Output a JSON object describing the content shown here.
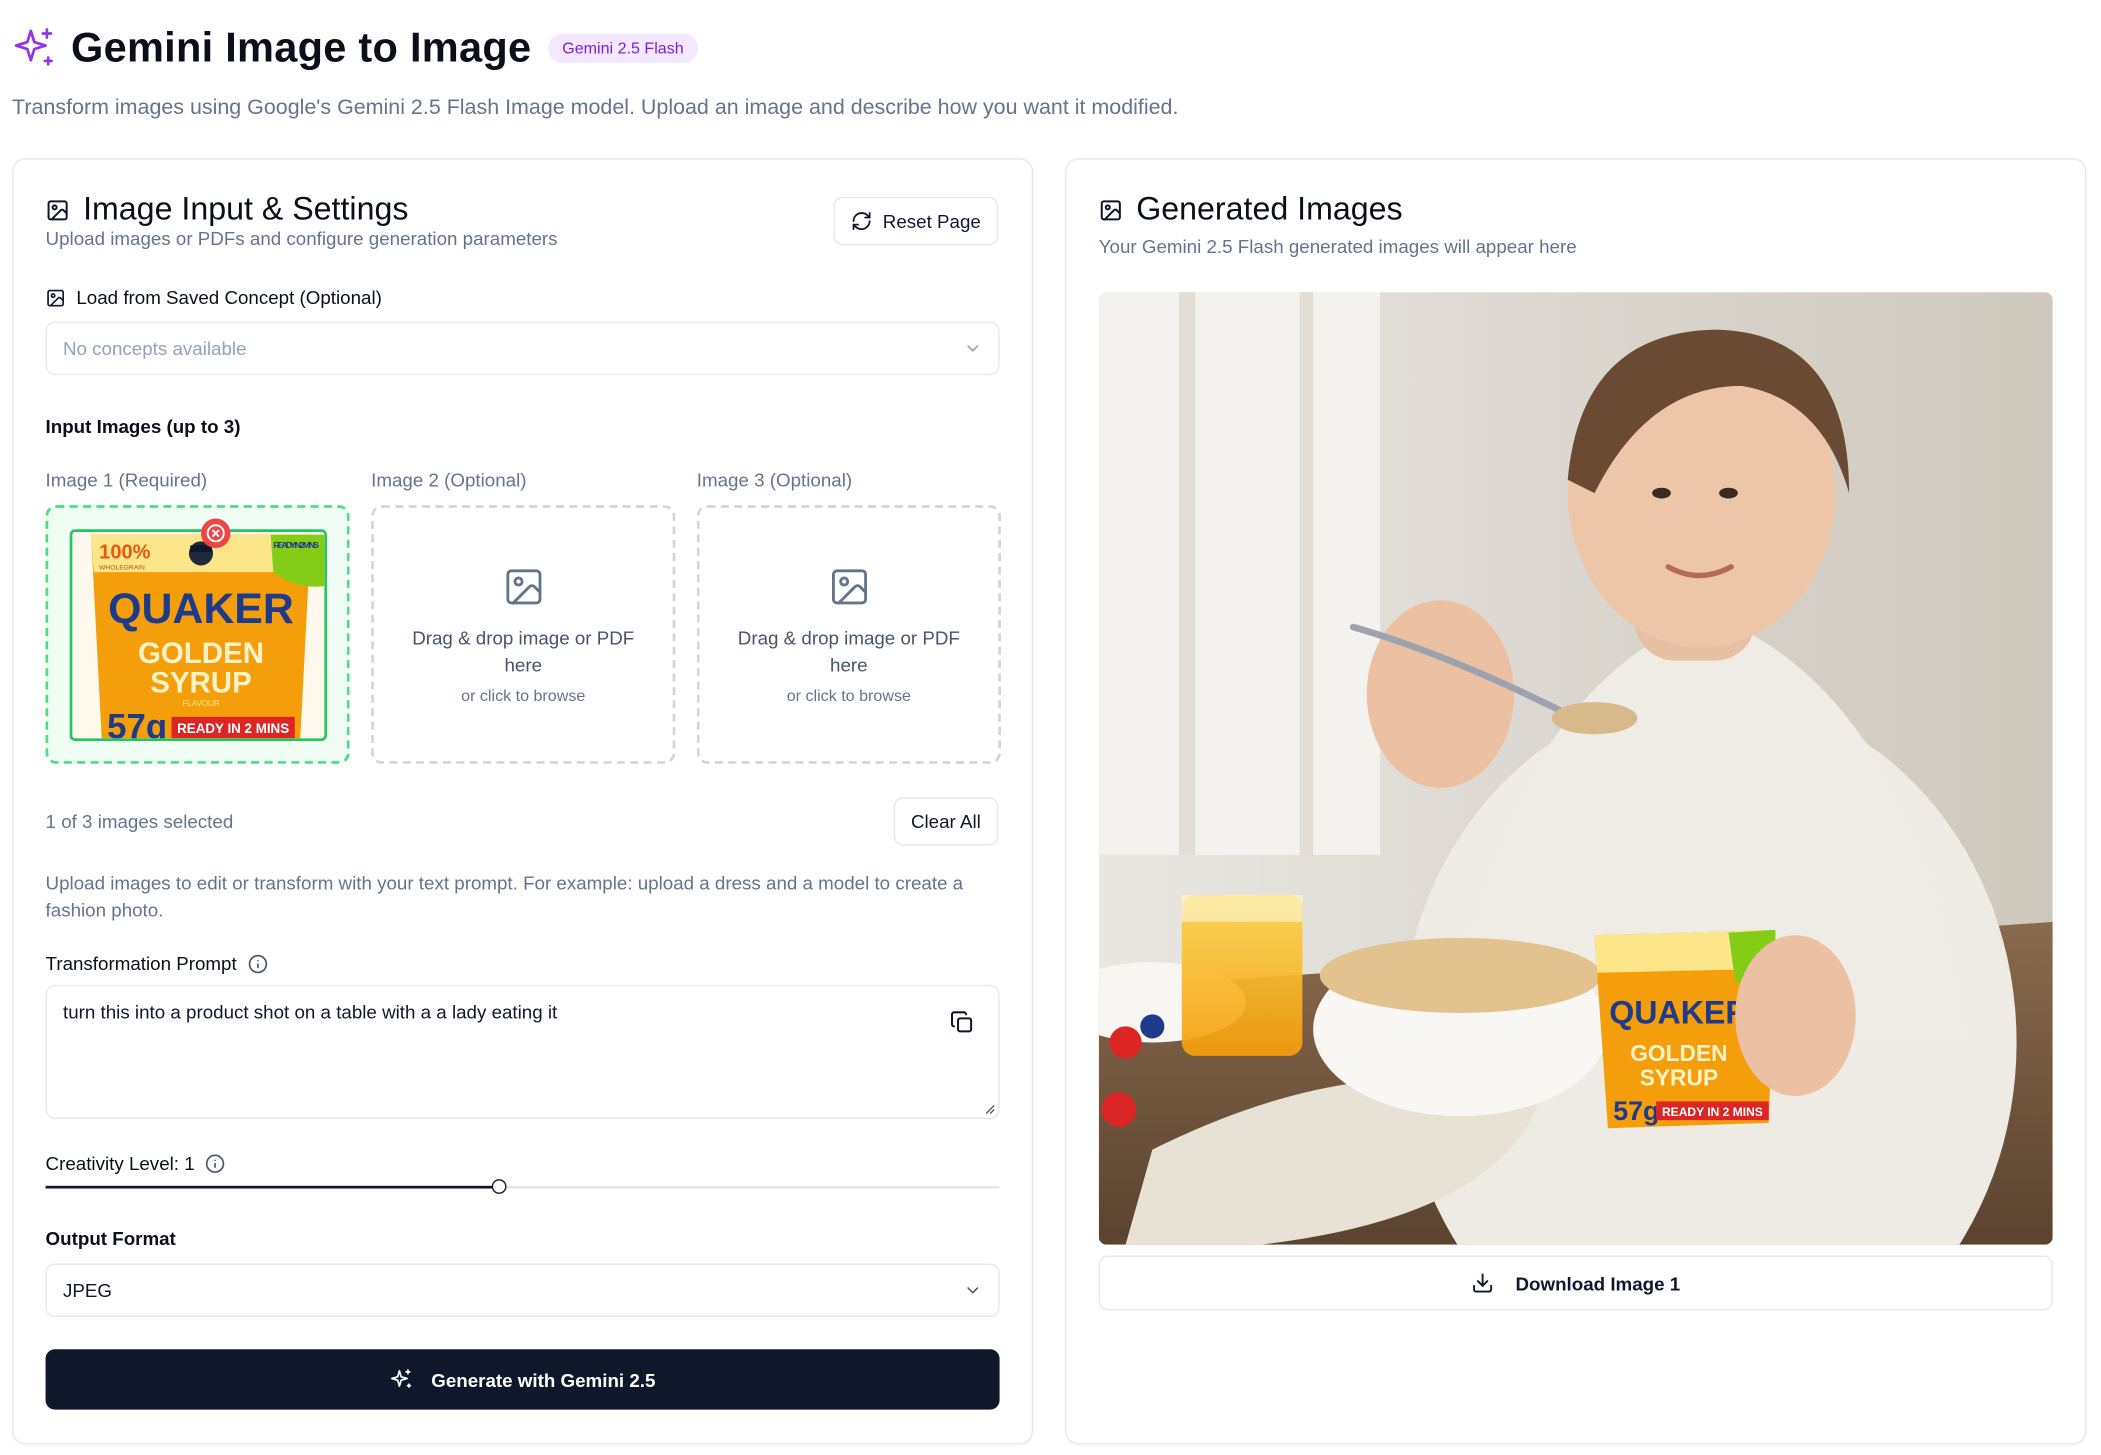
{
  "header": {
    "title": "Gemini Image to Image",
    "badge": "Gemini 2.5 Flash",
    "subtitle": "Transform images using Google's Gemini 2.5 Flash Image model. Upload an image and describe how you want it modified."
  },
  "left_panel": {
    "title": "Image Input & Settings",
    "subtitle": "Upload images or PDFs and configure generation parameters",
    "reset_label": "Reset Page",
    "concept": {
      "label": "Load from Saved Concept (Optional)",
      "placeholder": "No concepts available"
    },
    "input_images": {
      "label": "Input Images (up to 3)",
      "slots": [
        {
          "label": "Image 1 (Required)"
        },
        {
          "label": "Image 2 (Optional)",
          "drop_title": "Drag & drop image or PDF here",
          "drop_sub": "or click to browse"
        },
        {
          "label": "Image 3 (Optional)",
          "drop_title": "Drag & drop image or PDF here",
          "drop_sub": "or click to browse"
        }
      ],
      "product_text": {
        "wholegrain": "100%",
        "wholegrain_sub": "WHOLEGRAIN",
        "ready": "READY IN 2 MINS",
        "brand": "QUAKER",
        "flavour_line1": "GOLDEN",
        "flavour_line2": "SYRUP",
        "flavour_sub": "FLAVOUR",
        "weight": "57g",
        "ready_band": "READY IN 2 MINS"
      },
      "count_text": "1 of 3 images selected",
      "clear_label": "Clear All"
    },
    "help_text": "Upload images to edit or transform with your text prompt. For example: upload a dress and a model to create a fashion photo.",
    "prompt": {
      "label": "Transformation Prompt",
      "value": "turn this into a product shot on a table with a a lady eating it"
    },
    "creativity": {
      "label": "Creativity Level: 1",
      "value": 1,
      "fraction": 0.475
    },
    "output_format": {
      "label": "Output Format",
      "value": "JPEG"
    },
    "generate_label": "Generate with Gemini 2.5"
  },
  "right_panel": {
    "title": "Generated Images",
    "subtitle": "Your Gemini 2.5 Flash generated images will appear here",
    "download_label": "Download Image 1",
    "product_text": {
      "brand": "QUAKER",
      "flavour_line1": "GOLDEN",
      "flavour_line2": "SYRUP",
      "weight": "57g",
      "ready_band": "READY IN 2 MINS"
    }
  },
  "colors": {
    "accent": "#7e22ce",
    "primary_button": "#0f172a",
    "success_border": "#22c55e",
    "danger": "#ef4444"
  }
}
